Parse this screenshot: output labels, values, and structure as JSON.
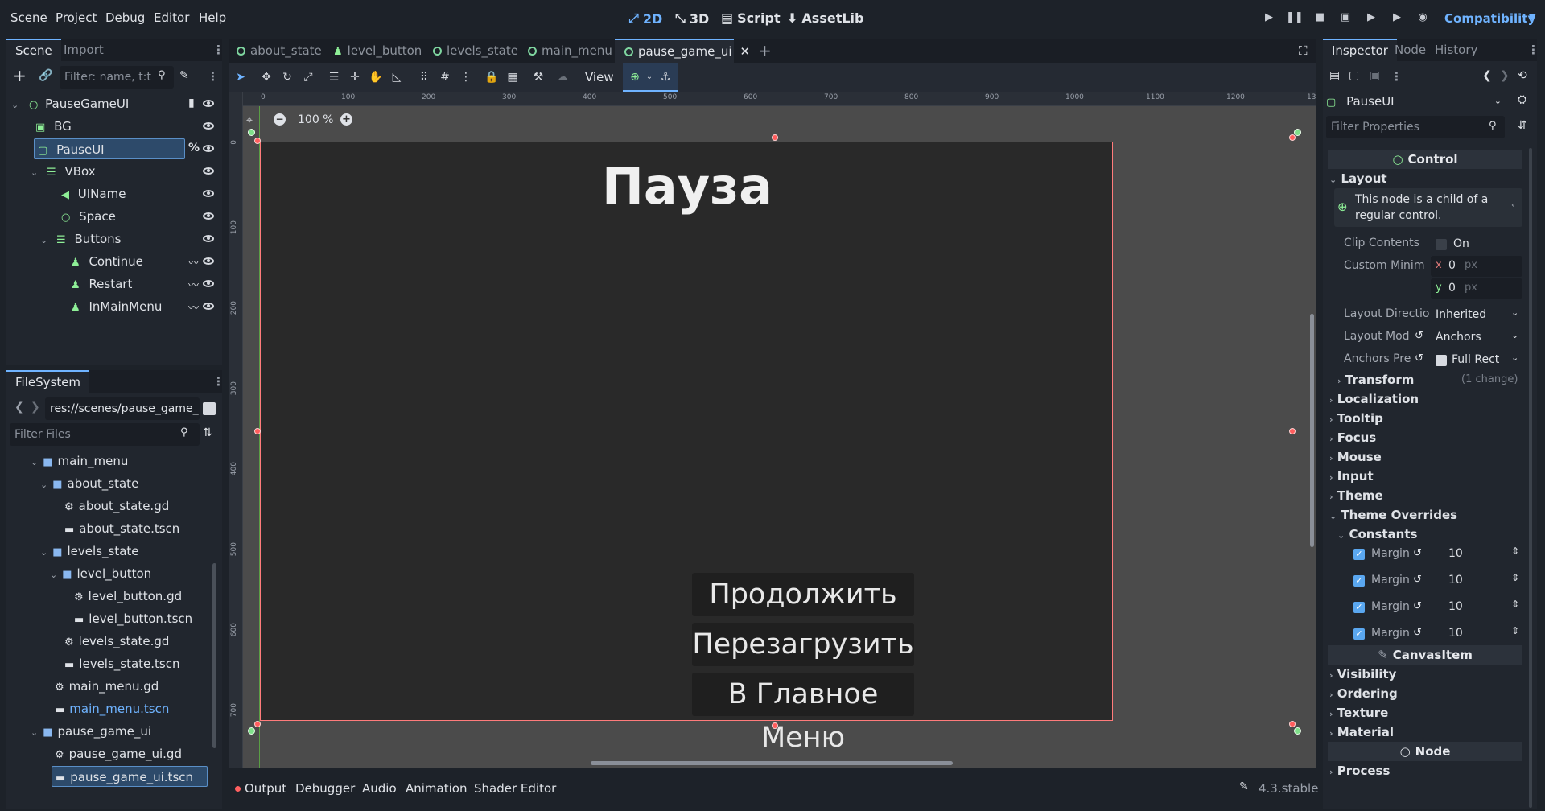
{
  "menu": [
    "Scene",
    "Project",
    "Debug",
    "Editor",
    "Help"
  ],
  "workspaces": {
    "w2d": "2D",
    "w3d": "3D",
    "script": "Script",
    "assetlib": "AssetLib"
  },
  "renderer": "Compatibility",
  "scene_dock": {
    "tabs": [
      "Scene",
      "Import"
    ],
    "filter_placeholder": "Filter: name, t:t",
    "nodes": [
      {
        "label": "PauseGameUI",
        "icon": "control-icon",
        "color": "#8eef97"
      },
      {
        "label": "BG",
        "icon": "panel-icon",
        "color": "#8eef97"
      },
      {
        "label": "PauseUI",
        "icon": "margin-container-icon",
        "color": "#8eef97"
      },
      {
        "label": "VBox",
        "icon": "vbox-icon",
        "color": "#8eef97"
      },
      {
        "label": "UIName",
        "icon": "label-icon",
        "color": "#8eef97"
      },
      {
        "label": "Space",
        "icon": "control-icon",
        "color": "#8eef97"
      },
      {
        "label": "Buttons",
        "icon": "vbox-icon",
        "color": "#8eef97"
      },
      {
        "label": "Continue",
        "icon": "button-icon",
        "color": "#8eef97"
      },
      {
        "label": "Restart",
        "icon": "button-icon",
        "color": "#8eef97"
      },
      {
        "label": "InMainMenu",
        "icon": "button-icon",
        "color": "#8eef97"
      }
    ],
    "pauseui_badge": "%"
  },
  "filesystem": {
    "tab": "FileSystem",
    "path": "res://scenes/pause_game_",
    "filter_placeholder": "Filter Files",
    "items": [
      {
        "label": "main_menu",
        "kind": "folder"
      },
      {
        "label": "about_state",
        "kind": "folder"
      },
      {
        "label": "about_state.gd",
        "kind": "script"
      },
      {
        "label": "about_state.tscn",
        "kind": "scene"
      },
      {
        "label": "levels_state",
        "kind": "folder"
      },
      {
        "label": "level_button",
        "kind": "folder"
      },
      {
        "label": "level_button.gd",
        "kind": "script"
      },
      {
        "label": "level_button.tscn",
        "kind": "scene"
      },
      {
        "label": "levels_state.gd",
        "kind": "script"
      },
      {
        "label": "levels_state.tscn",
        "kind": "scene"
      },
      {
        "label": "main_menu.gd",
        "kind": "script"
      },
      {
        "label": "main_menu.tscn",
        "kind": "scene"
      },
      {
        "label": "pause_game_ui",
        "kind": "folder"
      },
      {
        "label": "pause_game_ui.gd",
        "kind": "script"
      },
      {
        "label": "pause_game_ui.tscn",
        "kind": "scene"
      }
    ]
  },
  "editor_tabs": [
    "about_state",
    "level_button",
    "levels_state",
    "main_menu",
    "pause_game_ui"
  ],
  "toolbar": {
    "view": "View"
  },
  "zoom": "100 %",
  "ruler_labels": [
    "0",
    "100",
    "200",
    "300",
    "400",
    "500",
    "600",
    "700",
    "800",
    "900",
    "1000",
    "1100",
    "1200",
    "130"
  ],
  "ruler_v_labels": [
    "0",
    "100",
    "200",
    "300",
    "400",
    "500",
    "600",
    "700"
  ],
  "game": {
    "title": "Пауза",
    "buttons": [
      "Продолжить",
      "Перезагрузить",
      "В Главное Меню"
    ]
  },
  "bottom_tabs": [
    "Output",
    "Debugger",
    "Audio",
    "Animation",
    "Shader Editor"
  ],
  "version": "4.3.stable",
  "inspector": {
    "tabs": [
      "Inspector",
      "Node",
      "History"
    ],
    "node_name": "PauseUI",
    "filter_placeholder": "Filter Properties",
    "class_section": "Control",
    "layout_group": "Layout",
    "info": "This node is a child of a regular control.",
    "props": {
      "clip_contents": "Clip Contents",
      "clip_value": "On",
      "custom_min": "Custom Minim",
      "x_label": "x",
      "y_label": "y",
      "x_val": "0",
      "y_val": "0",
      "unit": "px",
      "layout_direction": "Layout Directio",
      "layout_direction_val": "Inherited",
      "layout_mode": "Layout Mod",
      "layout_mode_val": "Anchors",
      "anchors_preset": "Anchors Pre",
      "anchors_preset_val": "Full Rect"
    },
    "transform": "Transform",
    "transform_note": "(1 change)",
    "groups": [
      "Localization",
      "Tooltip",
      "Focus",
      "Mouse",
      "Input",
      "Theme",
      "Theme Overrides"
    ],
    "constants": "Constants",
    "margins": [
      {
        "label": "Margin",
        "value": "10"
      },
      {
        "label": "Margin",
        "value": "10"
      },
      {
        "label": "Margin",
        "value": "10"
      },
      {
        "label": "Margin",
        "value": "10"
      }
    ],
    "canvasitem": "CanvasItem",
    "canvas_groups": [
      "Visibility",
      "Ordering",
      "Texture",
      "Material"
    ],
    "node_section": "Node",
    "node_groups": [
      "Process"
    ]
  }
}
